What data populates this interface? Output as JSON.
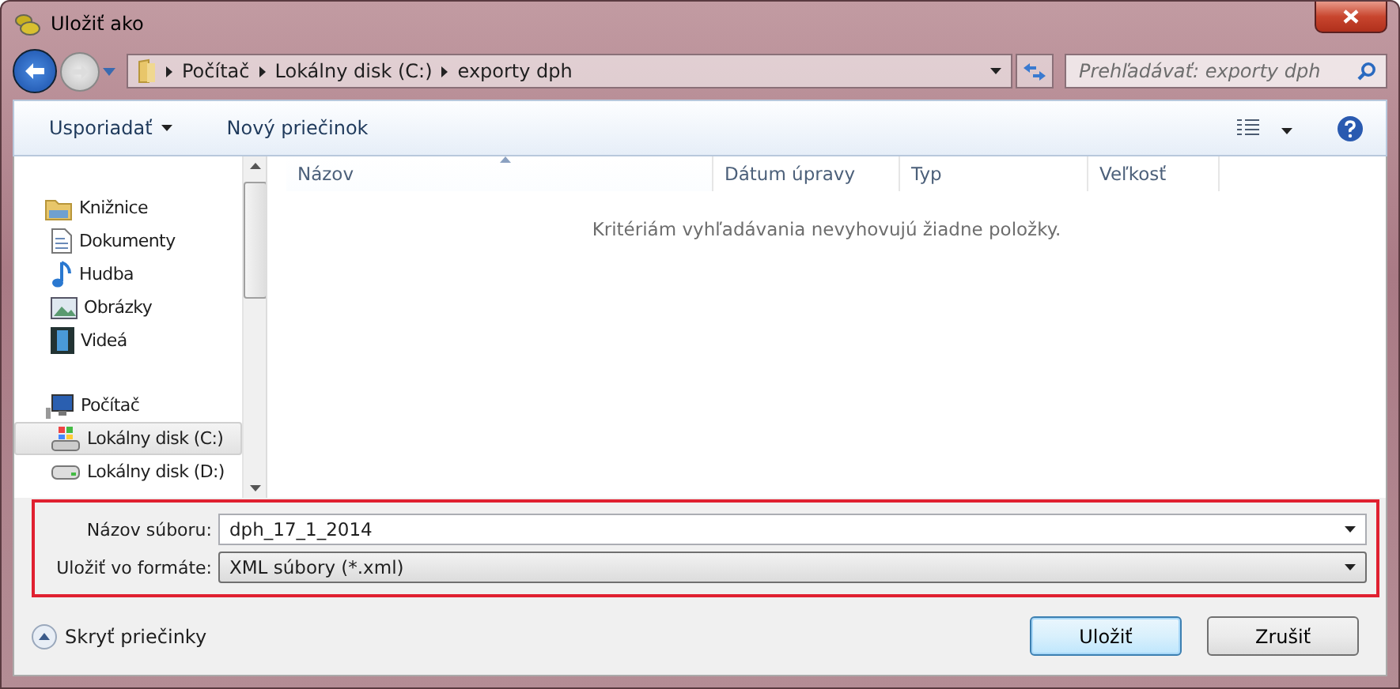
{
  "window": {
    "title": "Uložiť ako"
  },
  "address": {
    "crumbs": [
      "Počítač",
      "Lokálny disk (C:)",
      "exporty dph"
    ]
  },
  "search": {
    "placeholder": "Prehľadávať: exporty dph"
  },
  "toolbar": {
    "buttons": [
      {
        "label": "Usporiadať",
        "dropdown": true
      },
      {
        "label": "Nový priečinok",
        "dropdown": false
      }
    ]
  },
  "sidebar": {
    "groups": [
      {
        "label": "Knižnice",
        "kind": "library",
        "selected": false,
        "children": [
          {
            "label": "Dokumenty",
            "kind": "document",
            "selected": false
          },
          {
            "label": "Hudba",
            "kind": "music",
            "selected": false
          },
          {
            "label": "Obrázky",
            "kind": "pictures",
            "selected": false
          },
          {
            "label": "Videá",
            "kind": "video",
            "selected": false
          }
        ]
      },
      {
        "label": "Počítač",
        "kind": "computer",
        "selected": false,
        "children": [
          {
            "label": "Lokálny disk (C:)",
            "kind": "system-drive",
            "selected": true
          },
          {
            "label": "Lokálny disk (D:)",
            "kind": "drive",
            "selected": false
          }
        ]
      }
    ]
  },
  "table": {
    "columns": [
      {
        "label": "Názov",
        "sorted": true
      },
      {
        "label": "Dátum úpravy",
        "sorted": false
      },
      {
        "label": "Typ",
        "sorted": false
      },
      {
        "label": "Veľkosť",
        "sorted": false
      }
    ],
    "empty_message": "Kritériám vyhľadávania nevyhovujú žiadne položky."
  },
  "form": {
    "highlighted": true,
    "fields": [
      {
        "label": "Názov súboru:",
        "value": "dph_17_1_2014",
        "kind": "combo"
      },
      {
        "label": "Uložiť vo formáte:",
        "value": "XML súbory (*.xml)",
        "kind": "select"
      }
    ]
  },
  "hide_folders": {
    "label": "Skryť priečinky"
  },
  "buttons": [
    {
      "label": "Uložiť",
      "default": true
    },
    {
      "label": "Zrušiť",
      "default": false
    }
  ]
}
